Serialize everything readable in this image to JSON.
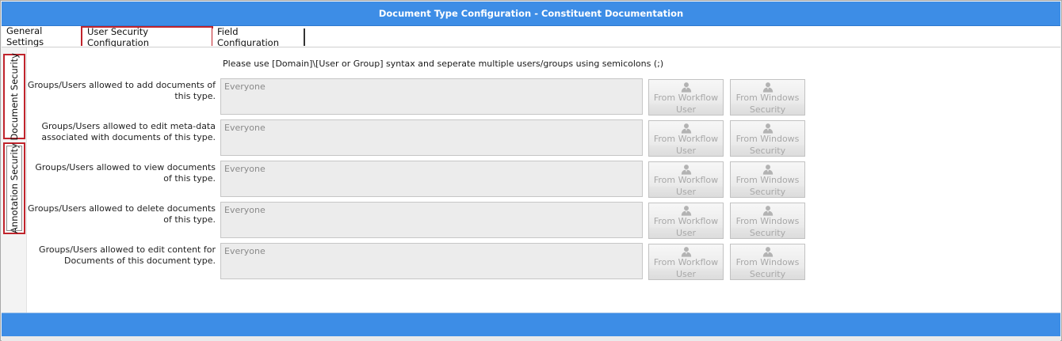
{
  "window": {
    "title": "Document Type Configuration - Constituent Documentation"
  },
  "tabs": [
    {
      "label": "General Settings"
    },
    {
      "label": "User Security Configuration"
    },
    {
      "label": "Field Configuration"
    }
  ],
  "side_tabs": [
    {
      "label": "Document Security"
    },
    {
      "label": "Annotation Security"
    }
  ],
  "hint": "Please use [Domain]\\[User or Group] syntax and seperate multiple users/groups using semicolons (;)",
  "buttons": {
    "workflow": {
      "line1": "From Workflow",
      "line2": "User"
    },
    "windows": {
      "line1": "From Windows",
      "line2": "Security"
    }
  },
  "rows": [
    {
      "label": "Groups/Users allowed to add documents of this type.",
      "value": "Everyone"
    },
    {
      "label": "Groups/Users allowed to edit meta-data associated with documents of this type.",
      "value": "Everyone"
    },
    {
      "label": "Groups/Users allowed to view documents of this type.",
      "value": "Everyone"
    },
    {
      "label": "Groups/Users allowed to delete documents of this type.",
      "value": "Everyone"
    },
    {
      "label": "Groups/Users allowed to edit content for Documents of this document type.",
      "value": "Everyone"
    }
  ],
  "icons": {
    "button_icon": "user-icon"
  },
  "colors": {
    "titlebar": "#3d8de6",
    "active_tab_border": "#c0242c"
  }
}
